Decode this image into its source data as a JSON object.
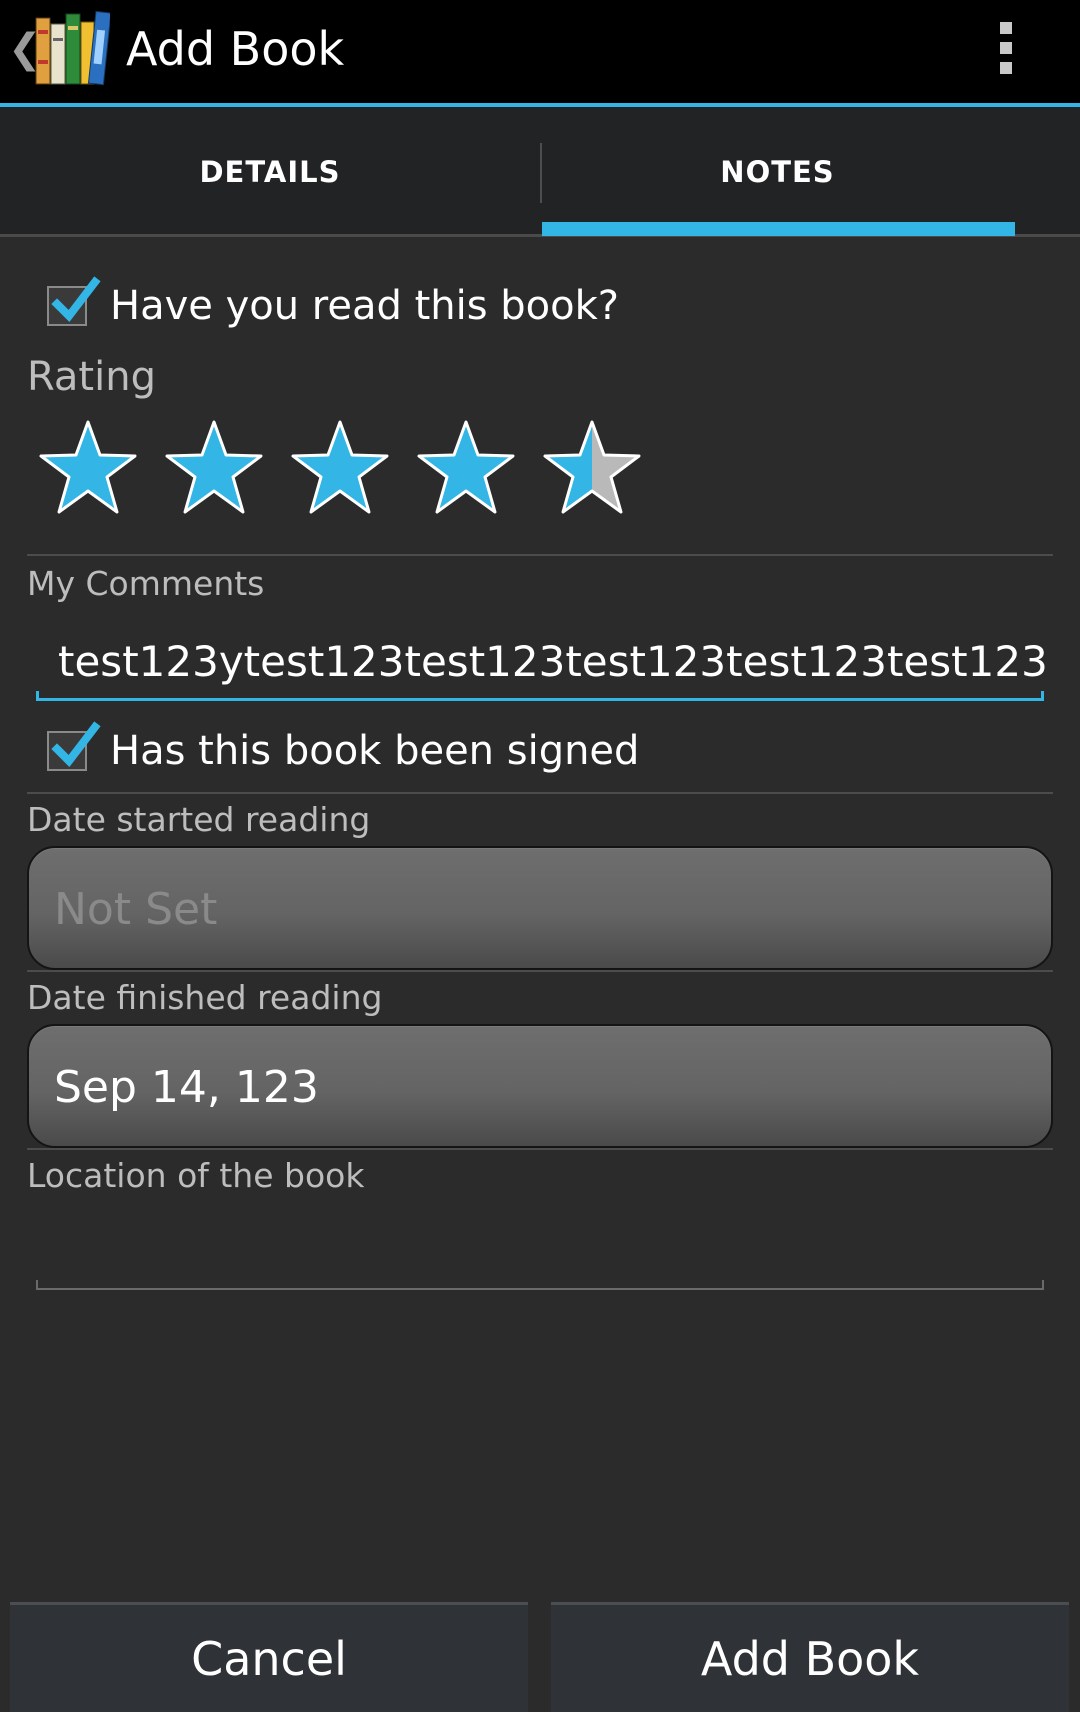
{
  "actionbar": {
    "title": "Add Book",
    "up_caret": "❮",
    "accent_color": "#33b5e5"
  },
  "tabs": [
    {
      "label": "DETAILS",
      "selected": false
    },
    {
      "label": "NOTES",
      "selected": true
    }
  ],
  "notes": {
    "read_checkbox": {
      "label": "Have you read this book?",
      "checked": true
    },
    "rating_label": "Rating",
    "rating": {
      "value": 4.5,
      "max": 5
    },
    "comments_label": "My Comments",
    "comments_value": "test123ytest123test123test123test123test123",
    "signed_checkbox": {
      "label": "Has this book been signed",
      "checked": true
    },
    "date_started_label": "Date started reading",
    "date_started_value": "Not Set",
    "date_finished_label": "Date finished reading",
    "date_finished_value": "Sep 14, 123",
    "location_label": "Location of the book",
    "location_value": ""
  },
  "buttons": {
    "cancel": "Cancel",
    "add_book": "Add Book"
  }
}
